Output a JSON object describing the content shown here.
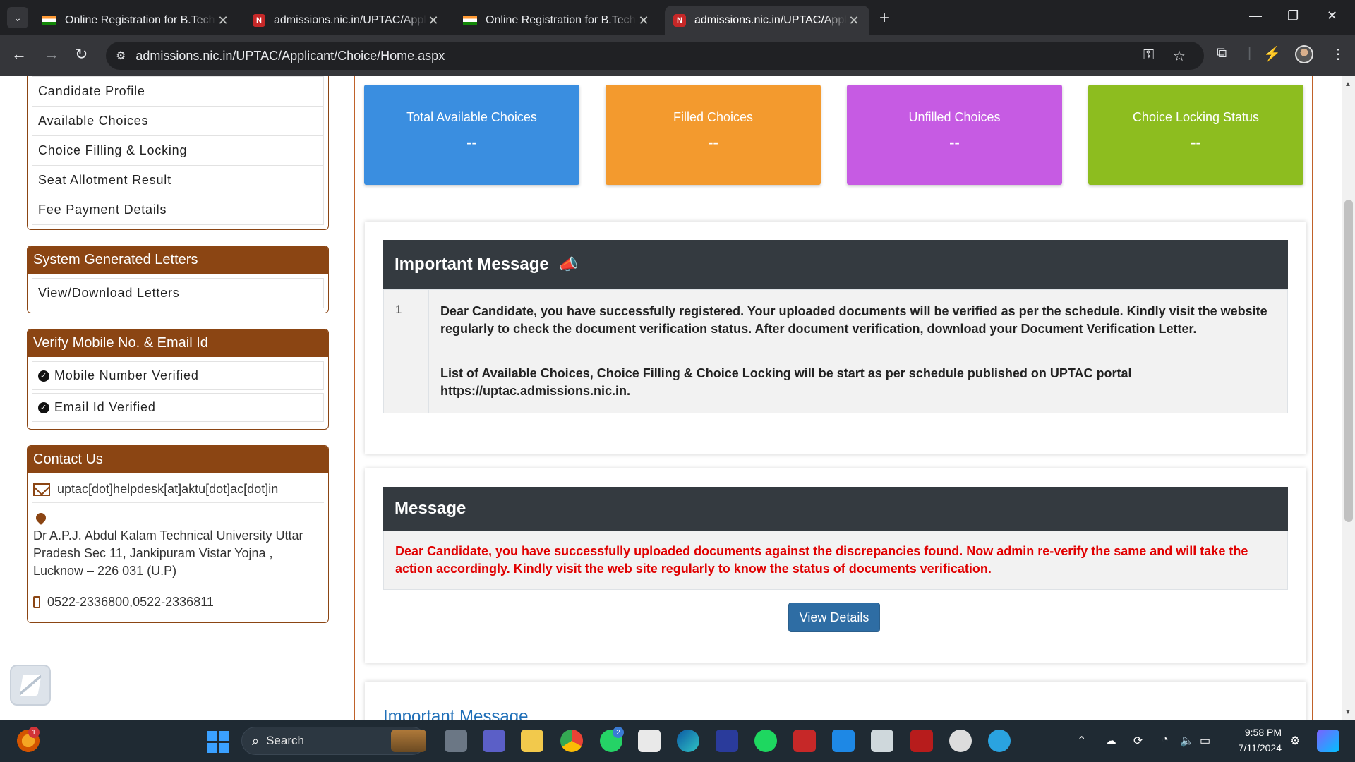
{
  "browser": {
    "tabs": [
      {
        "title": "Online Registration for B.Tech. Counselling",
        "favicon": "india-flag-icon",
        "active": false
      },
      {
        "title": "admissions.nic.in/UPTAC/Applicant",
        "favicon": "nic-icon",
        "active": false
      },
      {
        "title": "Online Registration for B.Tech. Counselling",
        "favicon": "india-flag-icon",
        "active": false
      },
      {
        "title": "admissions.nic.in/UPTAC/Applicant",
        "favicon": "nic-icon",
        "active": true
      }
    ],
    "url": "admissions.nic.in/UPTAC/Applicant/Choice/Home.aspx"
  },
  "sidebar": {
    "menu": [
      "Candidate Profile",
      "Available Choices",
      "Choice Filling & Locking",
      "Seat Allotment Result",
      "Fee Payment Details"
    ],
    "letters": {
      "title": "System Generated Letters",
      "items": [
        "View/Download Letters"
      ]
    },
    "verify": {
      "title": "Verify Mobile No. & Email Id",
      "items": [
        "Mobile Number Verified",
        "Email Id Verified"
      ]
    },
    "contact": {
      "title": "Contact Us",
      "email": "uptac[dot]helpdesk[at]aktu[dot]ac[dot]in",
      "address": "Dr A.P.J. Abdul Kalam Technical University Uttar Pradesh Sec 11, Jankipuram Vistar Yojna , Lucknow – 226 031 (U.P)",
      "phone": "0522-2336800,0522-2336811"
    }
  },
  "stats": [
    {
      "label": "Total Available Choices",
      "value": "--",
      "color": "#3a8ee0"
    },
    {
      "label": "Filled Choices",
      "value": "--",
      "color": "#f39a2e"
    },
    {
      "label": "Unfilled Choices",
      "value": "--",
      "color": "#c65be3"
    },
    {
      "label": "Choice Locking Status",
      "value": "--",
      "color": "#8dbd1f"
    }
  ],
  "important_message": {
    "title": "Important Message",
    "row_number": "1",
    "paragraph1": "Dear Candidate, you have successfully registered. Your uploaded documents will be verified as per the schedule. Kindly visit the website regularly to check the document verification status. After document verification, download your Document Verification Letter.",
    "paragraph2": "List of Available Choices, Choice Filling & Choice Locking will be start as per schedule published on UPTAC portal https://uptac.admissions.nic.in."
  },
  "message": {
    "title": "Message",
    "text": "Dear Candidate, you have successfully uploaded documents against the discrepancies found. Now admin re-verify the same and will take the action accordingly. Kindly visit the web site regularly to know the status of documents verification.",
    "button": "View Details"
  },
  "next_section_title": "Important Message",
  "taskbar": {
    "search_placeholder": "Search",
    "time": "9:58 PM",
    "date": "7/11/2024",
    "notification_count": "1",
    "whatsapp_badge": "2"
  }
}
